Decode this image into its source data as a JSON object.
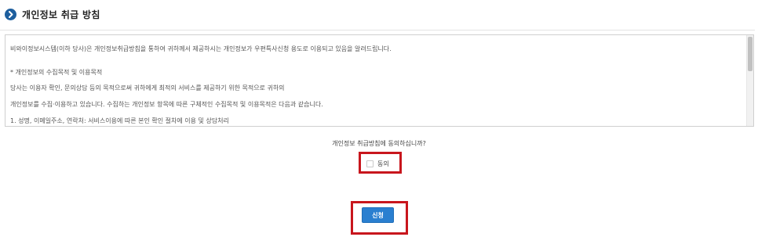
{
  "header": {
    "icon": "chevron-right-circle-icon",
    "title": "개인정보 취급 방침"
  },
  "policy": {
    "lines": [
      "비와이정보시스템(이하 당사)은 개인정보취급방침을 통하여 귀하께서 제공하시는 개인정보가 우편특사신청 용도로 이용되고 있음을 알려드립니다.",
      "* 개인정보의 수집목적 및 이용목적",
      "당사는 이용자 확인, 문의상담 등의 목적으로써 귀하에게 최적의 서비스를 제공하기 위한 목적으로 귀하의",
      "개인정보를 수집·이용하고 있습니다. 수집하는 개인정보 항목에 따른 구체적인 수집목적 및 이용목적은 다음과 같습니다.",
      "1. 성명, 이메일주소, 연락처: 서비스이용에 따른 본인 확인 절차에 이용 및 상담처리"
    ]
  },
  "consent": {
    "question": "개인정보 취급방침에 동의하십니까?",
    "agree_label": "동의",
    "agree_checked": false
  },
  "actions": {
    "submit_label": "신청"
  },
  "colors": {
    "accent": "#2a7fd0",
    "header_icon": "#1e5f9e",
    "highlight": "#c8161d"
  }
}
